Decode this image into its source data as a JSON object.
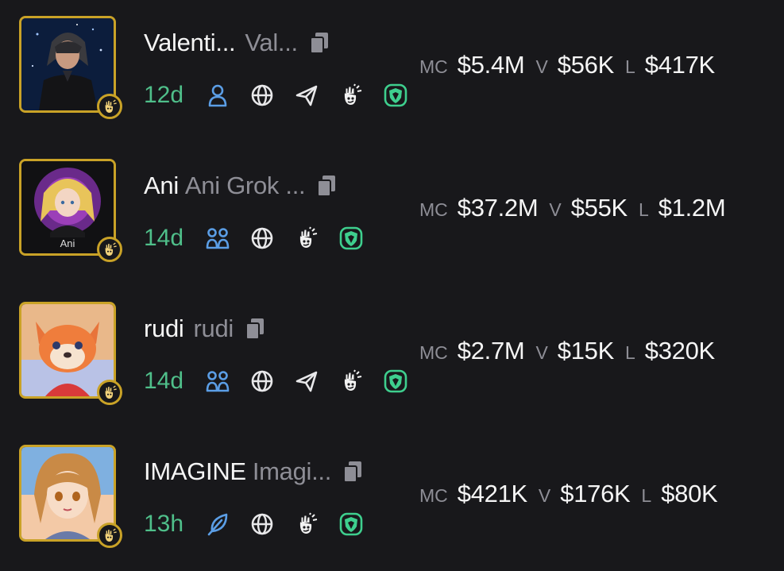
{
  "tokens": [
    {
      "name": "Valenti...",
      "full_name": "Val...",
      "age": "12d",
      "icons": [
        "user-icon",
        "globe-icon",
        "telegram-icon",
        "pump-icon",
        "shield-icon"
      ],
      "stats": {
        "mc_label": "MC",
        "mc": "$5.4M",
        "v_label": "V",
        "v": "$56K",
        "l_label": "L",
        "l": "$417K"
      }
    },
    {
      "name": "Ani",
      "full_name": "Ani Grok ...",
      "avatar_text": "Ani",
      "age": "14d",
      "icons": [
        "community-icon",
        "globe-icon",
        "pump-icon",
        "shield-icon"
      ],
      "stats": {
        "mc_label": "MC",
        "mc": "$37.2M",
        "v_label": "V",
        "v": "$55K",
        "l_label": "L",
        "l": "$1.2M"
      }
    },
    {
      "name": "rudi",
      "full_name": "rudi",
      "age": "14d",
      "icons": [
        "community-icon",
        "globe-icon",
        "telegram-icon",
        "pump-icon",
        "shield-icon"
      ],
      "stats": {
        "mc_label": "MC",
        "mc": "$2.7M",
        "v_label": "V",
        "v": "$15K",
        "l_label": "L",
        "l": "$320K"
      }
    },
    {
      "name": "IMAGINE",
      "full_name": "Imagi...",
      "age": "13h",
      "icons": [
        "feather-icon",
        "globe-icon",
        "pump-icon",
        "shield-icon"
      ],
      "stats": {
        "mc_label": "MC",
        "mc": "$421K",
        "v_label": "V",
        "v": "$176K",
        "l_label": "L",
        "l": "$80K"
      }
    }
  ],
  "colors": {
    "background": "#18181b",
    "gold_border": "#c9a227",
    "age_green": "#4fbf8a",
    "icon_blue": "#5b9ee6",
    "shield_green": "#3ecf8e",
    "muted_gray": "#8e8e96"
  }
}
